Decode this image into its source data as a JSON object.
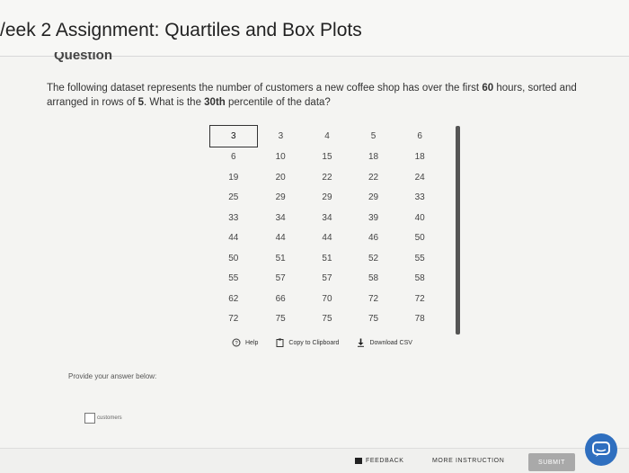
{
  "header": {
    "title": "/eek 2 Assignment: Quartiles and Box Plots"
  },
  "question": {
    "heading": "Question",
    "text_part1": "The following dataset represents the number of customers a new coffee shop has over the first ",
    "text_bold1": "60",
    "text_part2": " hours, sorted and arranged in rows of ",
    "text_bold2": "5",
    "text_part3": ". What is the ",
    "text_bold3": "30th",
    "text_part4": " percentile of the data?"
  },
  "dataset": {
    "rows": [
      [
        "3",
        "3",
        "4",
        "5",
        "6"
      ],
      [
        "6",
        "10",
        "15",
        "18",
        "18"
      ],
      [
        "19",
        "20",
        "22",
        "22",
        "24"
      ],
      [
        "25",
        "29",
        "29",
        "29",
        "33"
      ],
      [
        "33",
        "34",
        "34",
        "39",
        "40"
      ],
      [
        "44",
        "44",
        "44",
        "46",
        "50"
      ],
      [
        "50",
        "51",
        "51",
        "52",
        "55"
      ],
      [
        "55",
        "57",
        "57",
        "58",
        "58"
      ],
      [
        "62",
        "66",
        "70",
        "72",
        "72"
      ],
      [
        "72",
        "75",
        "75",
        "75",
        "78"
      ]
    ]
  },
  "tools": {
    "help_label": "Help",
    "copy_label": "Copy to Clipboard",
    "download_label": "Download CSV"
  },
  "answer": {
    "prompt": "Provide your answer below:",
    "unit": "customers",
    "value": ""
  },
  "footer": {
    "feedback_label": "FEEDBACK",
    "more_label": "MORE INSTRUCTION",
    "submit_label": "SUBMIT"
  },
  "colors": {
    "chat_button": "#2f6fbf",
    "submit_button": "#a9a9a9"
  },
  "icons": {
    "help": "help-circle-icon",
    "copy": "clipboard-icon",
    "download": "download-arrow-icon",
    "feedback": "feedback-flag-icon",
    "chat": "chat-bubble-icon"
  }
}
